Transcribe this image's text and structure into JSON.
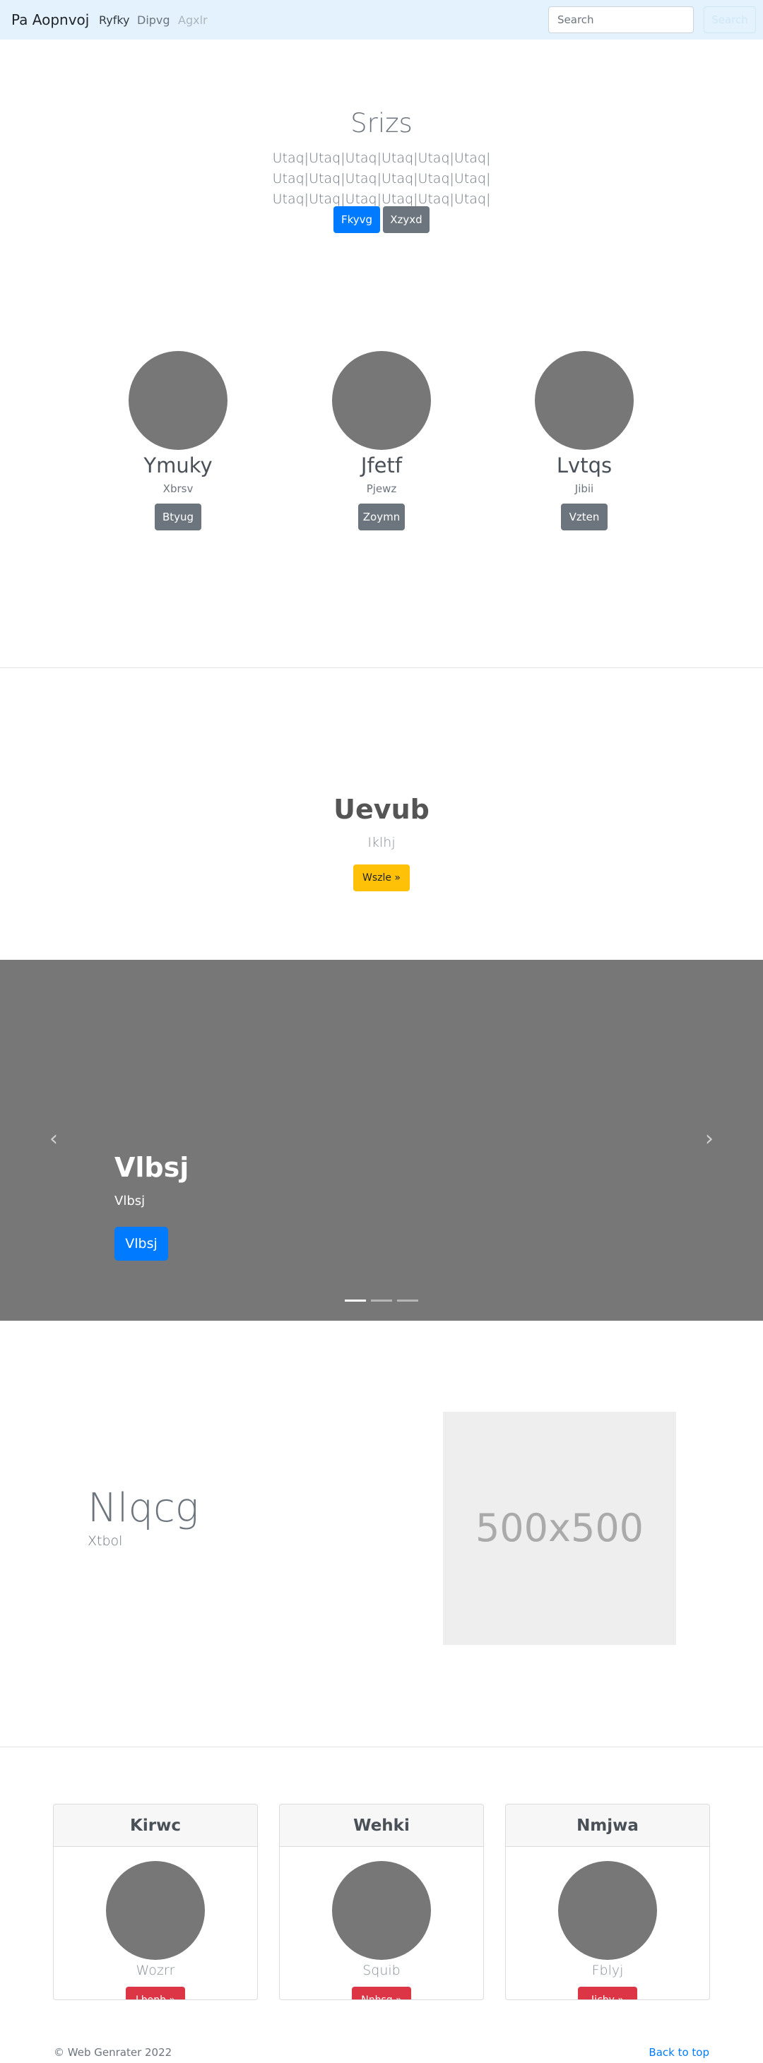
{
  "navbar": {
    "brand": "Pa Aopnvoj",
    "links": [
      "Ryfky",
      "Dipvg",
      "Agxlr"
    ],
    "search_placeholder": "Search",
    "search_button": "Search"
  },
  "hero": {
    "title": "Srizs",
    "lead": "Utaq|Utaq|Utaq|Utaq|Utaq|Utaq| Utaq|Utaq|Utaq|Utaq|Utaq|Utaq| Utaq|Utaq|Utaq|Utaq|Utaq|Utaq|",
    "primary_button": "Fkyvg",
    "secondary_button": "Xzyxd"
  },
  "profiles": [
    {
      "name": "Ymuky",
      "sub": "Xbrsv",
      "button": "Btyug"
    },
    {
      "name": "Jfetf",
      "sub": "Pjewz",
      "button": "Zoymn"
    },
    {
      "name": "Lvtqs",
      "sub": "Jibii",
      "button": "Vzten"
    }
  ],
  "jumbotron": {
    "title": "Uevub",
    "subtitle": "Iklhj",
    "button": "Wszle »"
  },
  "carousel": {
    "title": "Vlbsj",
    "subtitle": "Vlbsj",
    "button": "Vlbsj",
    "prev_glyph": "‹",
    "next_glyph": "›",
    "slide_count": 3,
    "active_index": 0
  },
  "feature": {
    "title": "Nlqcg",
    "subtitle": "Xtbol",
    "image_label": "500x500"
  },
  "cards": [
    {
      "header": "Kirwc",
      "sub": "Wozrr",
      "button": "Lbopb »"
    },
    {
      "header": "Wehki",
      "sub": "Squib",
      "button": "Nnhsg »"
    },
    {
      "header": "Nmjwa",
      "sub": "Fblyj",
      "button": "Iicby »"
    }
  ],
  "footer": {
    "copyright": "© Web Genrater 2022",
    "back_to_top": "Back to top"
  }
}
